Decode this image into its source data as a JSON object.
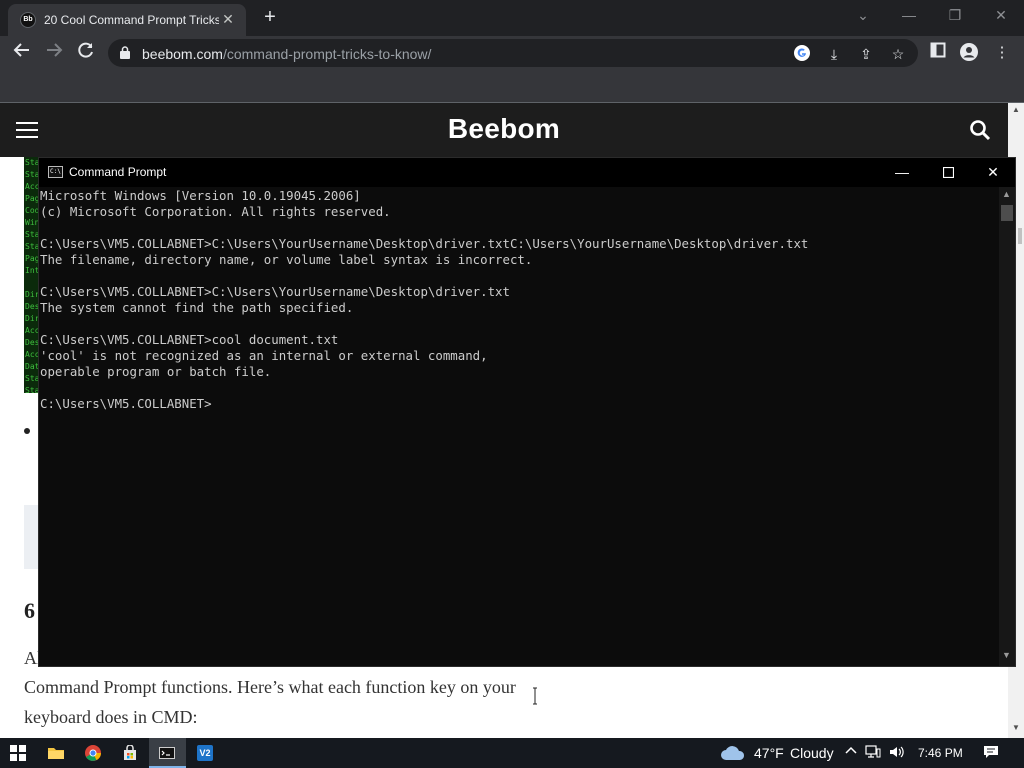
{
  "browser": {
    "tab_title": "20 Cool Command Prompt Tricks",
    "tab_favicon_text": "Bb",
    "url_host": "beebom.com",
    "url_path": "/command-prompt-tricks-to-know/",
    "icons": [
      "back-icon",
      "forward-icon",
      "reload-icon",
      "lock-icon",
      "google-icon",
      "install-icon",
      "share-icon",
      "star-icon",
      "sidebar-icon",
      "profile-icon",
      "more-icon"
    ]
  },
  "site": {
    "logo": "Beebom",
    "heading_fragment": "6",
    "para_line1": "Al",
    "para_line2": "Command Prompt functions. Here’s what each function key on your",
    "para_line3": "keyboard does in CMD:",
    "thumb_text": "Sta\nSta\nAcc\nPag\nCod\nWin\nSta\nSta\nPag\nInt\n\nDir\nDes\nDir\nAcc\nDes\nAcc\nDat\nSta\nSta"
  },
  "cmd": {
    "title": "Command Prompt",
    "icon_text": "C:\\",
    "lines": [
      "Microsoft Windows [Version 10.0.19045.2006]",
      "(c) Microsoft Corporation. All rights reserved.",
      "",
      "C:\\Users\\VM5.COLLABNET>C:\\Users\\YourUsername\\Desktop\\driver.txtC:\\Users\\YourUsername\\Desktop\\driver.txt",
      "The filename, directory name, or volume label syntax is incorrect.",
      "",
      "C:\\Users\\VM5.COLLABNET>C:\\Users\\YourUsername\\Desktop\\driver.txt",
      "The system cannot find the path specified.",
      "",
      "C:\\Users\\VM5.COLLABNET>cool document.txt",
      "'cool' is not recognized as an internal or external command,",
      "operable program or batch file.",
      "",
      "C:\\Users\\VM5.COLLABNET>"
    ]
  },
  "taskbar": {
    "items": [
      "start",
      "file-explorer",
      "chrome",
      "store",
      "command-prompt",
      "vm-app"
    ],
    "active_item": "command-prompt",
    "vm_label": "V2",
    "weather_temp": "47°F",
    "weather_desc": "Cloudy",
    "time": "7:46 PM"
  },
  "colors": {
    "chrome_dark": "#202124",
    "chrome_toolbar": "#35363a",
    "site_header": "#1d1d1d",
    "cmd_bg": "#0c0c0c",
    "cmd_text": "#cccccc",
    "taskbar": "#15191f"
  }
}
